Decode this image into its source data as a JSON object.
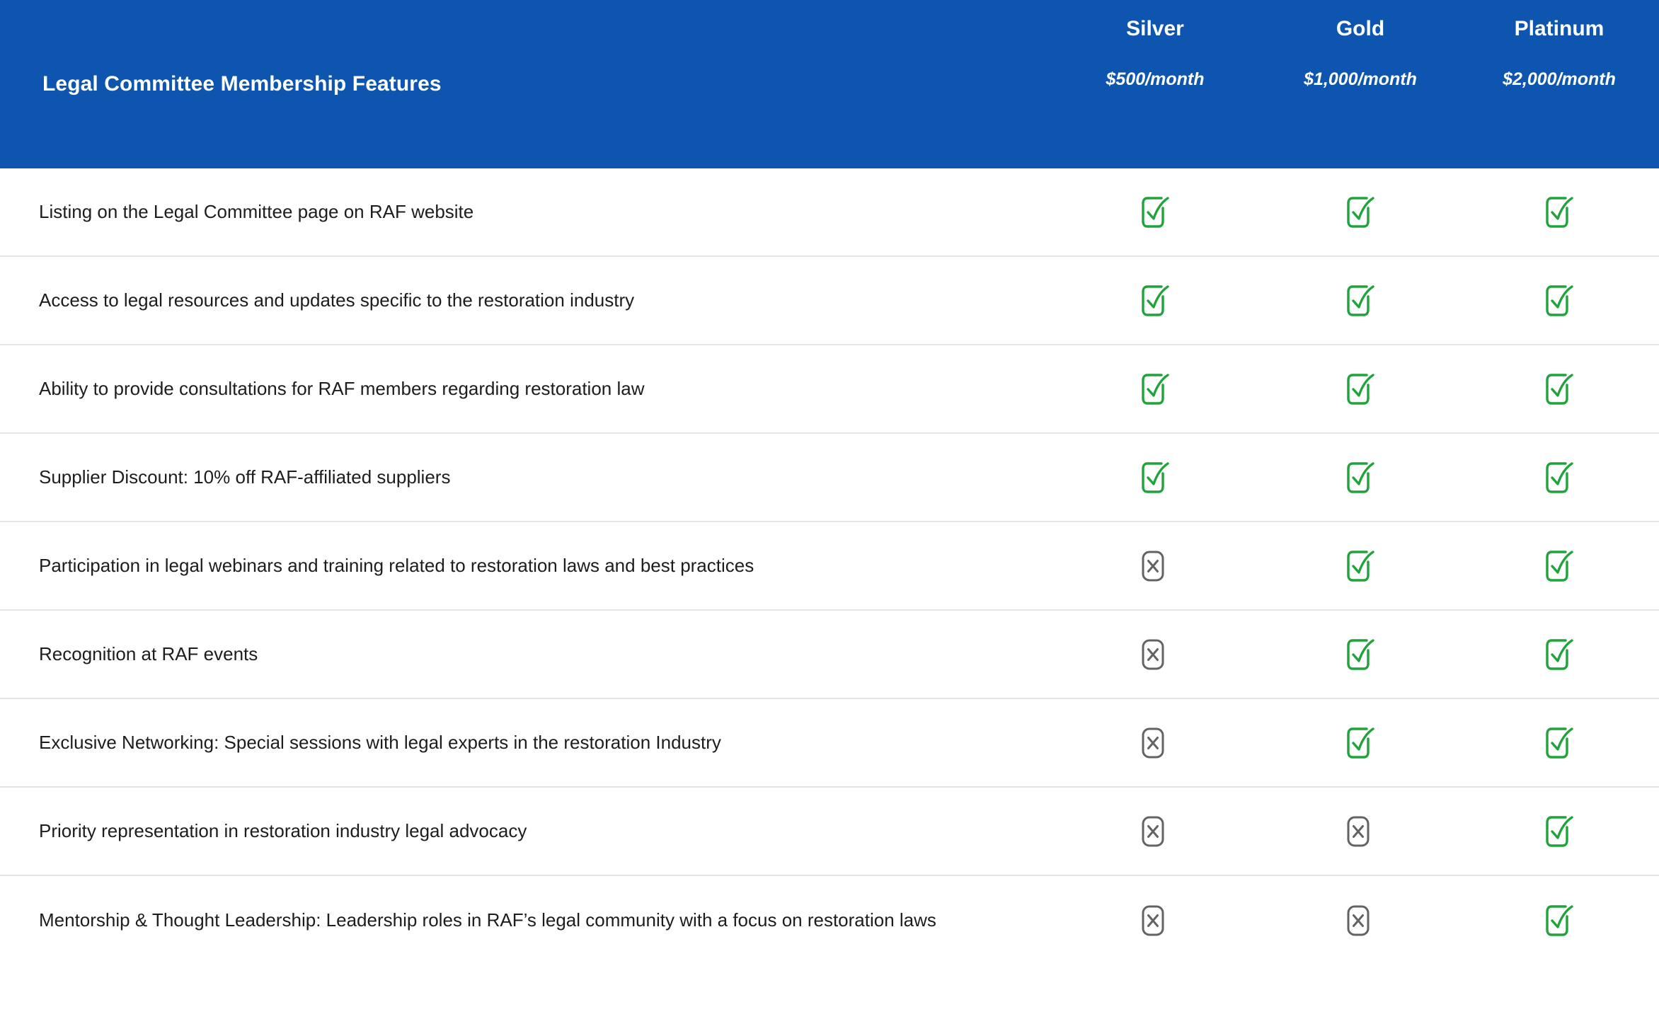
{
  "header": {
    "title": "Legal Committee Membership Features",
    "background_color": "#0d55ae",
    "text_color": "#ffffff",
    "tiers": [
      {
        "name": "Silver",
        "price": "$500/month"
      },
      {
        "name": "Gold",
        "price": "$1,000/month"
      },
      {
        "name": "Platinum",
        "price": "$2,000/month"
      }
    ]
  },
  "icons": {
    "included": "check-square-icon",
    "excluded": "x-square-icon",
    "included_color": "#1fa33a",
    "excluded_color": "#636363"
  },
  "table": {
    "columns": [
      "Legal Committee Membership Features",
      "Silver",
      "Gold",
      "Platinum"
    ],
    "rows": [
      {
        "feature": "Listing on the Legal Committee page on RAF website",
        "silver": "included",
        "gold": "included",
        "platinum": "included"
      },
      {
        "feature": "Access to legal resources and updates specific to the restoration industry",
        "silver": "included",
        "gold": "included",
        "platinum": "included"
      },
      {
        "feature": "Ability to provide consultations for RAF members regarding restoration law",
        "silver": "included",
        "gold": "included",
        "platinum": "included"
      },
      {
        "feature": "Supplier Discount: 10% off RAF-affiliated suppliers",
        "silver": "included",
        "gold": "included",
        "platinum": "included"
      },
      {
        "feature": "Participation in legal webinars and training related to restoration laws and best practices",
        "silver": "excluded",
        "gold": "included",
        "platinum": "included"
      },
      {
        "feature": "Recognition at RAF events",
        "silver": "excluded",
        "gold": "included",
        "platinum": "included"
      },
      {
        "feature": "Exclusive Networking: Special sessions with legal experts in the restoration Industry",
        "silver": "excluded",
        "gold": "included",
        "platinum": "included"
      },
      {
        "feature": "Priority representation in restoration industry legal advocacy",
        "silver": "excluded",
        "gold": "excluded",
        "platinum": "included"
      },
      {
        "feature": "Mentorship & Thought Leadership: Leadership roles in RAF’s legal community with a focus on restoration laws",
        "silver": "excluded",
        "gold": "excluded",
        "platinum": "included"
      }
    ]
  }
}
